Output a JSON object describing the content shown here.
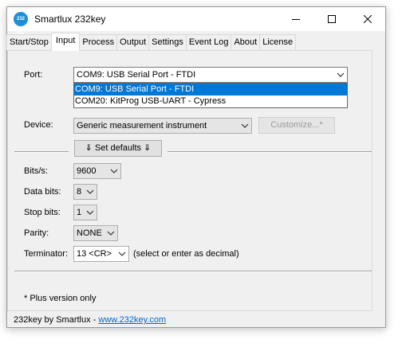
{
  "window": {
    "title": "Smartlux 232key",
    "icon_text": "232\nkey"
  },
  "tabs": [
    {
      "label": "Start/Stop",
      "active": false
    },
    {
      "label": "Input",
      "active": true
    },
    {
      "label": "Process",
      "active": false
    },
    {
      "label": "Output",
      "active": false
    },
    {
      "label": "Settings",
      "active": false
    },
    {
      "label": "Event Log",
      "active": false
    },
    {
      "label": "About",
      "active": false
    },
    {
      "label": "License",
      "active": false
    }
  ],
  "port": {
    "label": "Port:",
    "value": "COM9: USB Serial Port - FTDI",
    "options": [
      "COM9: USB Serial Port - FTDI",
      "COM20: KitProg USB-UART - Cypress"
    ],
    "selected_index": 0
  },
  "device": {
    "label": "Device:",
    "value": "Generic measurement instrument",
    "customize_label": "Customize...*"
  },
  "set_defaults_label": "⇓ Set defaults ⇓",
  "serial": {
    "bits_label": "Bits/s:",
    "bits_value": "9600",
    "data_bits_label": "Data bits:",
    "data_bits_value": "8",
    "stop_bits_label": "Stop bits:",
    "stop_bits_value": "1",
    "parity_label": "Parity:",
    "parity_value": "NONE",
    "terminator_label": "Terminator:",
    "terminator_value": "13 <CR>",
    "terminator_hint": "(select or enter as decimal)"
  },
  "footnote": "* Plus version only",
  "status": {
    "prefix": "232key by Smartlux - ",
    "link": "www.232key.com"
  },
  "colors": {
    "selection": "#0078d7",
    "link": "#0066cc"
  }
}
